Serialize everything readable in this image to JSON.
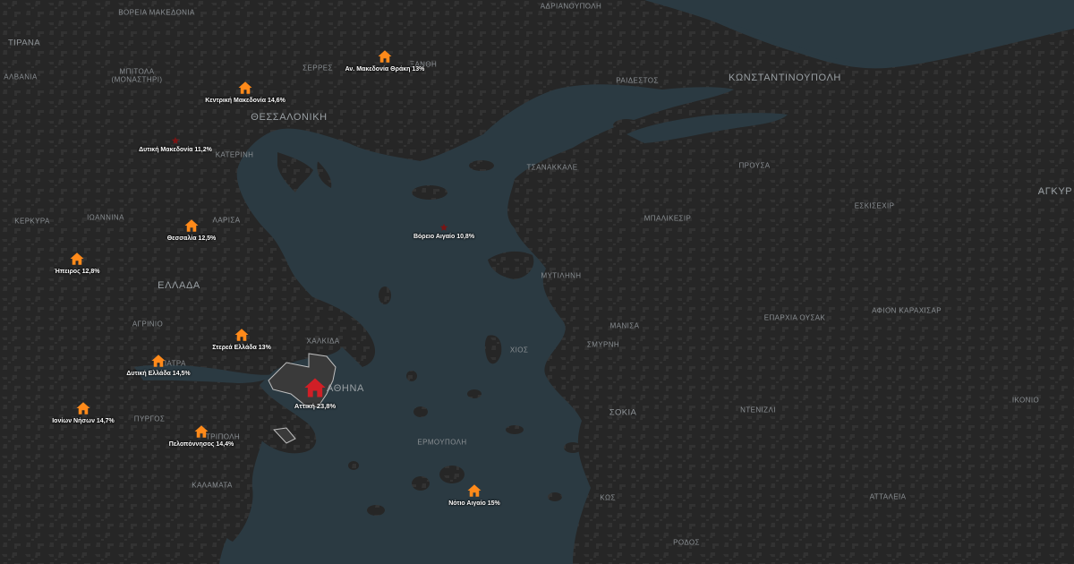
{
  "colors": {
    "sea": "#2b3a42",
    "land": "#262626",
    "land_texture": "#333333",
    "marker_orange": "#ff8a1a",
    "marker_red": "#d11f26",
    "marker_star": "#7a1414",
    "highlight_region": "#3a3a3a",
    "highlight_border": "#bfbfbf"
  },
  "places": {
    "vorea_makedonia": "ΒΟΡΕΙΑ ΜΑΚΕΔΟΝΙΑ",
    "tirana": "ΤΙΡΑΝΑ",
    "albania": "ΑΛΒΑΝΙΑ",
    "bitola": "ΜΠΙΤΟΛΑ",
    "bitola_alt": "(ΜΟΝΑΣΤΗΡΙ)",
    "serres": "ΣΕΡΡΕΣ",
    "xanthi": "ΞΑΝΘΗ",
    "adrianoupoli": "ΑΔΡΙΑΝΟΥΠΟΛΗ",
    "raidestos": "ΡΑΙΔΕΣΤΟΣ",
    "konstantinoupoli": "ΚΩΝΣΤΑΝΤΙΝΟΥΠΟΛΗ",
    "thessaloniki": "ΘΕΣΣΑΛΟΝΙΚΗ",
    "katerini": "ΚΑΤΕΡΙΝΗ",
    "tsanakkale": "ΤΣΑΝΑΚΚΑΛΕ",
    "prousa": "ΠΡΟΥΣΑ",
    "agkyra": "ΑΓΚΥΡ",
    "kerkyra": "ΚΕΡΚΥΡΑ",
    "ioannina": "ΙΩΑΝΝΙΝΑ",
    "larisa": "ΛΑΡΙΣΑ",
    "eskisehir": "ΕΣΚΙΣΕΧΙΡ",
    "balikesir": "ΜΠΑΛΙΚΕΣΙΡ",
    "mytilini": "ΜΥΤΙΛΗΝΗ",
    "ellada": "ΕΛΛΑΔΑ",
    "agrinio": "ΑΓΡΙΝΙΟ",
    "manisa": "ΜΑΝΙΣΑ",
    "eparchia_ousak": "ΕΠΑΡΧΙΑ ΟΥΣΑΚ",
    "afion": "ΑΦΙΟΝ ΚΑΡΑΧΙΣΑΡ",
    "smyrni": "ΣΜΥΡΝΗ",
    "chalkida": "ΧΑΛΚΙΔΑ",
    "chios": "ΧΙΟΣ",
    "patra": "ΠΑΤΡΑ",
    "athina": "ΑΘΗΝΑ",
    "ikonio": "ΙΚΟΝΙΟ",
    "pyrgos": "ΠΥΡΓΟΣ",
    "tripoli": "ΤΡΙΠΟΛΗ",
    "soke": "ΣΟΚΙΑ",
    "denizli": "ΝΤΕΝΙΖΛΙ",
    "ermoupoli": "ΕΡΜΟΥΠΟΛΗ",
    "kalamata": "ΚΑΛΑΜΑΤΑ",
    "kos": "ΚΩΣ",
    "attaleia": "ΑΤΤΑΛΕΙΑ",
    "rodos": "ΡΟΔΟΣ"
  },
  "markers": [
    {
      "region": "Αν. Μακεδονία Θράκη",
      "value": "13%",
      "label": "Αν. Μακεδονία Θράκη 13%",
      "icon": "house-icon",
      "color": "orange"
    },
    {
      "region": "Κεντρική Μακεδονία",
      "value": "14,6%",
      "label": "Κεντρική Μακεδονία 14,6%",
      "icon": "house-icon",
      "color": "orange"
    },
    {
      "region": "Δυτική Μακεδονία",
      "value": "11,2%",
      "label": "Δυτική Μακεδονία 11,2%",
      "icon": "star-icon",
      "color": "dark-red"
    },
    {
      "region": "Θεσσαλία",
      "value": "12,5%",
      "label": "Θεσσαλία 12,5%",
      "icon": "house-icon",
      "color": "orange"
    },
    {
      "region": "Ήπειρος",
      "value": "12,8%",
      "label": "Ήπειρος 12,8%",
      "icon": "house-icon",
      "color": "orange"
    },
    {
      "region": "Βόρειο Αιγαίο",
      "value": "10,8%",
      "label": "Βόρειο Αιγαίο 10,8%",
      "icon": "star-icon",
      "color": "dark-red"
    },
    {
      "region": "Στερεά Ελλάδα",
      "value": "13%",
      "label": "Στερεά Ελλάδα 13%",
      "icon": "house-icon",
      "color": "orange"
    },
    {
      "region": "Δυτική Ελλάδα",
      "value": "14,5%",
      "label": "Δυτική Ελλάδα 14,5%",
      "icon": "house-icon",
      "color": "orange"
    },
    {
      "region": "Αττική",
      "value": "23,8%",
      "label": "Αττική 23,8%",
      "icon": "house-icon",
      "color": "red"
    },
    {
      "region": "Ιονίων Νήσων",
      "value": "14,7%",
      "label": "Ιονίων Νήσων 14,7%",
      "icon": "house-icon",
      "color": "orange"
    },
    {
      "region": "Πελοπόννησος",
      "value": "14,4%",
      "label": "Πελοπόννησος 14,4%",
      "icon": "house-icon",
      "color": "orange"
    },
    {
      "region": "Νότιο Αιγαίο",
      "value": "15%",
      "label": "Νότιο Αιγαίο 15%",
      "icon": "house-icon",
      "color": "orange"
    }
  ]
}
